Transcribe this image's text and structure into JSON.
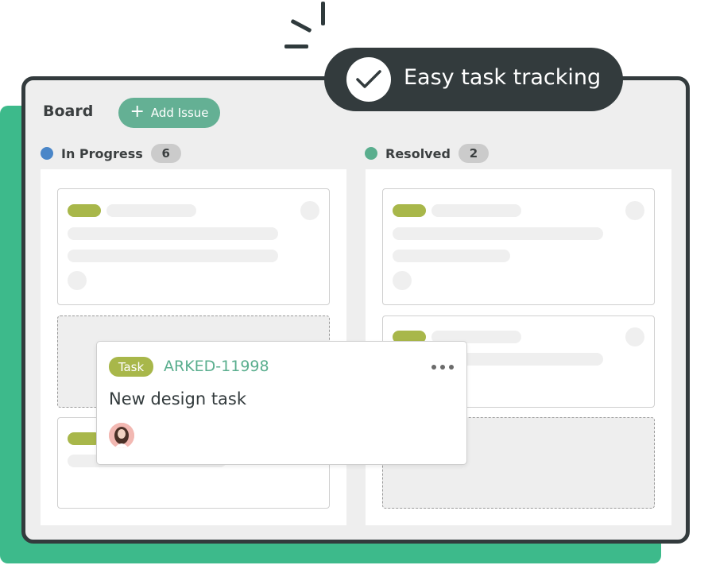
{
  "colors": {
    "accent_green": "#3dba8b",
    "button_green": "#64b094",
    "dark": "#333b3d",
    "tag_olive": "#a8b74a",
    "in_progress_dot": "#4a86c8",
    "resolved_dot": "#5aae8e"
  },
  "board": {
    "title": "Board",
    "add_issue_label": "Add Issue",
    "add_issue_icon": "plus-icon"
  },
  "banner": {
    "text": "Easy task tracking",
    "icon": "check-icon"
  },
  "columns": [
    {
      "label": "In Progress",
      "count": "6"
    },
    {
      "label": "Resolved",
      "count": "2"
    }
  ],
  "task_card": {
    "tag": "Task",
    "id": "ARKED-11998",
    "title": "New design task",
    "menu_icon": "more-horizontal-icon",
    "avatar_icon": "user-avatar"
  }
}
